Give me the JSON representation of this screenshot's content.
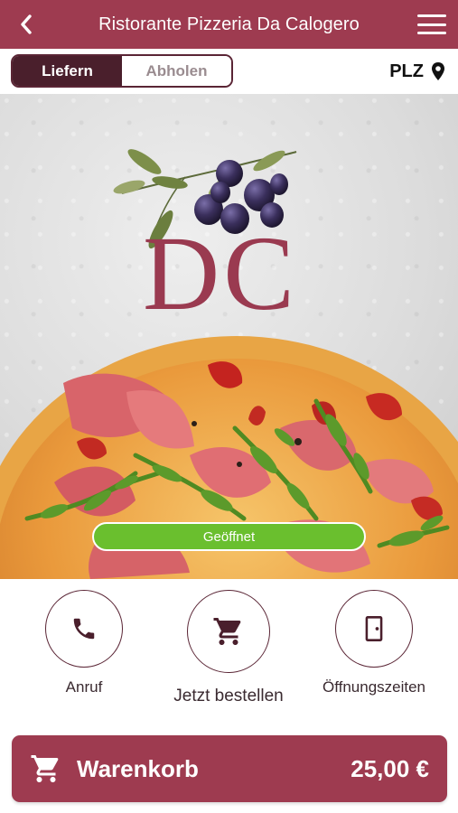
{
  "header": {
    "title": "Ristorante Pizzeria Da Calogero",
    "back_icon": "chevron-left-icon",
    "menu_icon": "hamburger-menu-icon"
  },
  "mode_toggle": {
    "options": [
      {
        "label": "Liefern",
        "active": true
      },
      {
        "label": "Abholen",
        "active": false
      }
    ]
  },
  "postal_code": {
    "label": "PLZ",
    "icon": "map-pin-icon"
  },
  "hero": {
    "logo_text": "DC",
    "status": "Geöffnet",
    "status_color": "#6abf2e"
  },
  "actions": [
    {
      "label": "Anruf",
      "icon": "phone-icon"
    },
    {
      "label": "Jetzt bestellen",
      "icon": "shopping-cart-icon"
    },
    {
      "label": "Öffnungszeiten",
      "icon": "door-icon"
    }
  ],
  "cart": {
    "label": "Warenkorb",
    "total": "25,00 €",
    "icon": "shopping-cart-icon"
  },
  "colors": {
    "brand": "#9e3b50",
    "brand_dark": "#4a1f2c",
    "status_green": "#6abf2e"
  }
}
